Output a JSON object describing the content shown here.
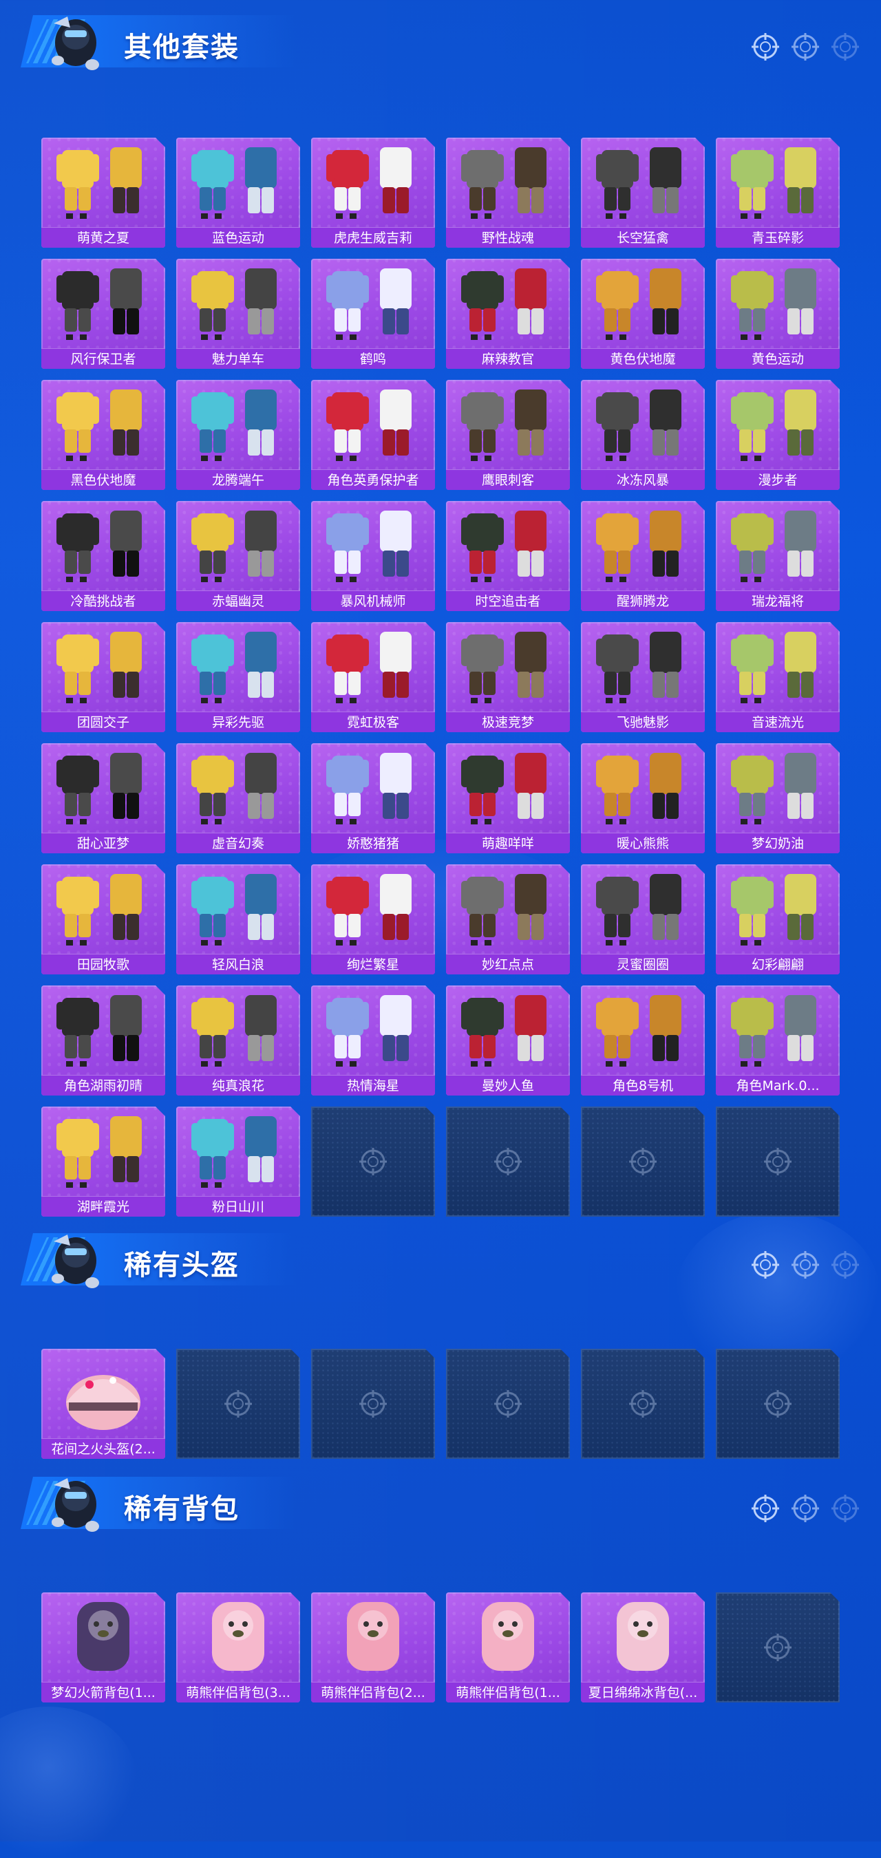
{
  "sections": [
    {
      "title": "其他套装",
      "items": [
        "萌黄之夏",
        "蓝色运动",
        "虎虎生威吉莉",
        "野性战魂",
        "长空猛禽",
        "青玉碎影",
        "风行保卫者",
        "魅力单车",
        "鹤鸣",
        "麻辣教官",
        "黄色伏地魔",
        "黄色运动",
        "黑色伏地魔",
        "龙腾端午",
        "角色英勇保护者",
        "鹰眼刺客",
        "冰冻风暴",
        "漫步者",
        "冷酷挑战者",
        "赤蝠幽灵",
        "暴风机械师",
        "时空追击者",
        "醒狮腾龙",
        "瑞龙福将",
        "团圆交子",
        "异彩先驱",
        "霓虹极客",
        "极速竞梦",
        "飞驰魅影",
        "音速流光",
        "甜心亚梦",
        "虚音幻奏",
        "娇憨猪猪",
        "萌趣咩咩",
        "暖心熊熊",
        "梦幻奶油",
        "田园牧歌",
        "轻风白浪",
        "绚烂繁星",
        "妙红点点",
        "灵蜜圈圈",
        "幻彩翩翩",
        "角色湖雨初晴",
        "纯真浪花",
        "热情海星",
        "曼妙人鱼",
        "角色8号机",
        "角色Mark.0...",
        "湖畔霞光",
        "粉日山川"
      ],
      "empty_slots": 4
    },
    {
      "title": "稀有头盔",
      "items": [
        "花间之火头盔(2..."
      ],
      "empty_slots": 5
    },
    {
      "title": "稀有背包",
      "items": [
        "梦幻火箭背包(1...",
        "萌熊伴侣背包(3...",
        "萌熊伴侣背包(2...",
        "萌熊伴侣背包(1...",
        "夏日绵绵冰背包(..."
      ],
      "empty_slots": 1
    }
  ],
  "colors": {
    "background": "#0b57de",
    "card": "#9c49e6",
    "card_label": "#8e36e0",
    "empty_slot": "#16366e"
  }
}
